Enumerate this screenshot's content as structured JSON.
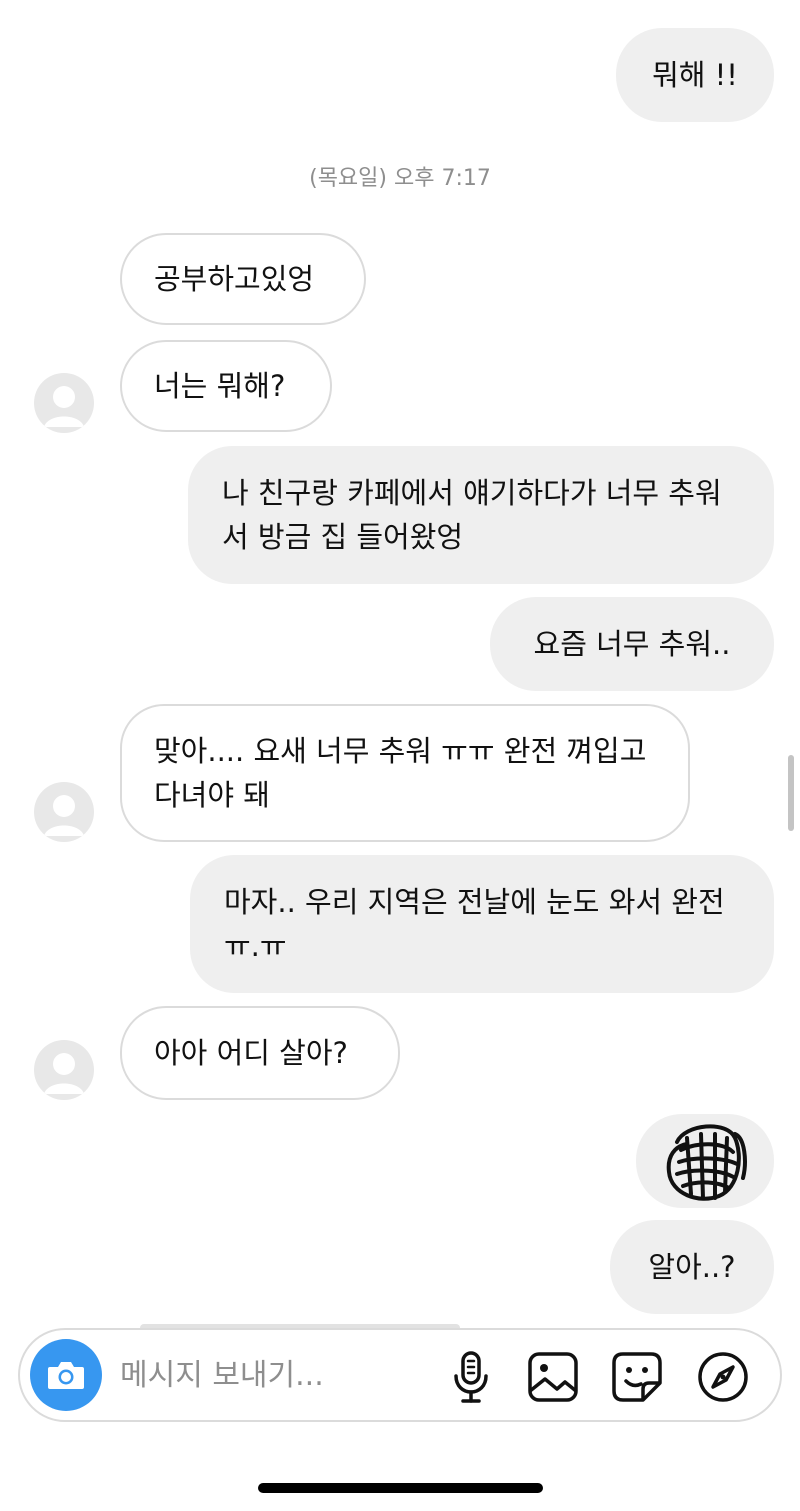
{
  "conversation": {
    "timestamp": "(목요일) 오후 7:17",
    "messages": [
      {
        "side": "sent",
        "text": "뭐해 !!"
      },
      {
        "side": "received",
        "text": "공부하고있엉"
      },
      {
        "side": "received",
        "text": "너는 뭐해?"
      },
      {
        "side": "sent",
        "text": "나 친구랑 카페에서 얘기하다가 너무 추워서 방금 집 들어왔엉"
      },
      {
        "side": "sent",
        "text": "요즘 너무 추워.."
      },
      {
        "side": "received",
        "text": "맞아.... 요새 너무 추워 ㅠㅠ 완전 껴입고 다녀야 돼"
      },
      {
        "side": "sent",
        "text": "마자.. 우리 지역은 전날에 눈도 와서 완전 ㅠ.ㅠ"
      },
      {
        "side": "received",
        "text": "아아 어디 살아?"
      },
      {
        "side": "sent",
        "text": "redacted-scribble"
      },
      {
        "side": "sent",
        "text": "알아..?"
      }
    ]
  },
  "composer": {
    "placeholder": "메시지 보내기...",
    "icons": [
      "camera-icon",
      "microphone-icon",
      "gallery-icon",
      "sticker-icon",
      "explore-icon"
    ]
  },
  "colors": {
    "sent_bubble": "#efefef",
    "received_border": "#dbdbdb",
    "accent": "#3797f0",
    "timestamp": "#8e8e8e"
  }
}
